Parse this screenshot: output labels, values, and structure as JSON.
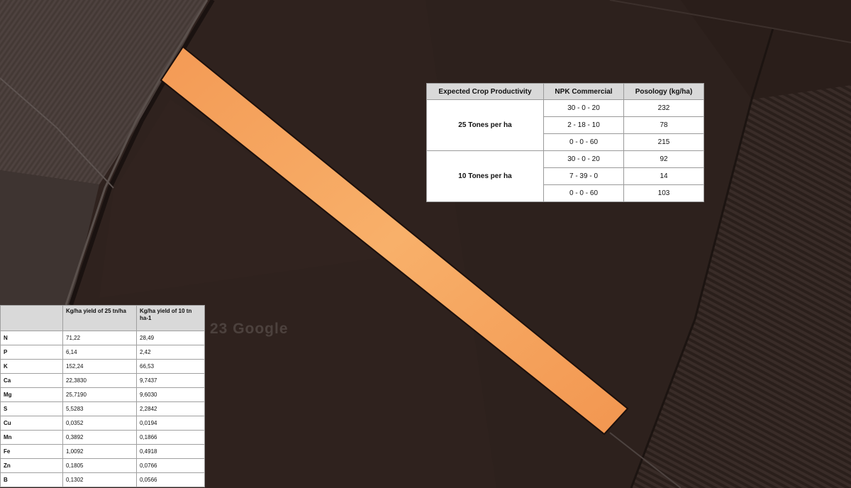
{
  "map": {
    "watermark": "23 Google",
    "colors": {
      "field": "#2e211d",
      "field_dark": "#241a17",
      "field_light": "#4a3f3b",
      "strip_fill": "#f7a45c",
      "strip_edge": "#1a0f0c"
    }
  },
  "npk_table": {
    "headers": [
      "Expected Crop Productivity",
      "NPK Commercial",
      "Posology (kg/ha)"
    ],
    "groups": [
      {
        "label": "25 Tones per ha",
        "rows": [
          {
            "npk": "30 - 0 - 20",
            "posology": "232"
          },
          {
            "npk": "2 - 18 - 10",
            "posology": "78"
          },
          {
            "npk": "0 - 0 - 60",
            "posology": "215"
          }
        ]
      },
      {
        "label": "10 Tones per ha",
        "rows": [
          {
            "npk": "30 - 0 - 20",
            "posology": "92"
          },
          {
            "npk": "7 - 39 - 0",
            "posology": "14"
          },
          {
            "npk": "0 - 0 - 60",
            "posology": "103"
          }
        ]
      }
    ]
  },
  "nutrient_table": {
    "headers": [
      "",
      "Kg/ha yield of 25 tn/ha",
      "Kg/ha yield of 10 tn ha-1"
    ],
    "rows": [
      {
        "element": "N",
        "y25": "71,22",
        "y10": "28,49"
      },
      {
        "element": "P",
        "y25": "6,14",
        "y10": "2,42"
      },
      {
        "element": "K",
        "y25": "152,24",
        "y10": "66,53"
      },
      {
        "element": "Ca",
        "y25": "22,3830",
        "y10": "9,7437"
      },
      {
        "element": "Mg",
        "y25": "25,7190",
        "y10": "9,6030"
      },
      {
        "element": "S",
        "y25": "5,5283",
        "y10": "2,2842"
      },
      {
        "element": "Cu",
        "y25": "0,0352",
        "y10": "0,0194"
      },
      {
        "element": "Mn",
        "y25": "0,3892",
        "y10": "0,1866"
      },
      {
        "element": "Fe",
        "y25": "1,0092",
        "y10": "0,4918"
      },
      {
        "element": "Zn",
        "y25": "0,1805",
        "y10": "0,0766"
      },
      {
        "element": "B",
        "y25": "0,1302",
        "y10": "0,0566"
      }
    ]
  }
}
